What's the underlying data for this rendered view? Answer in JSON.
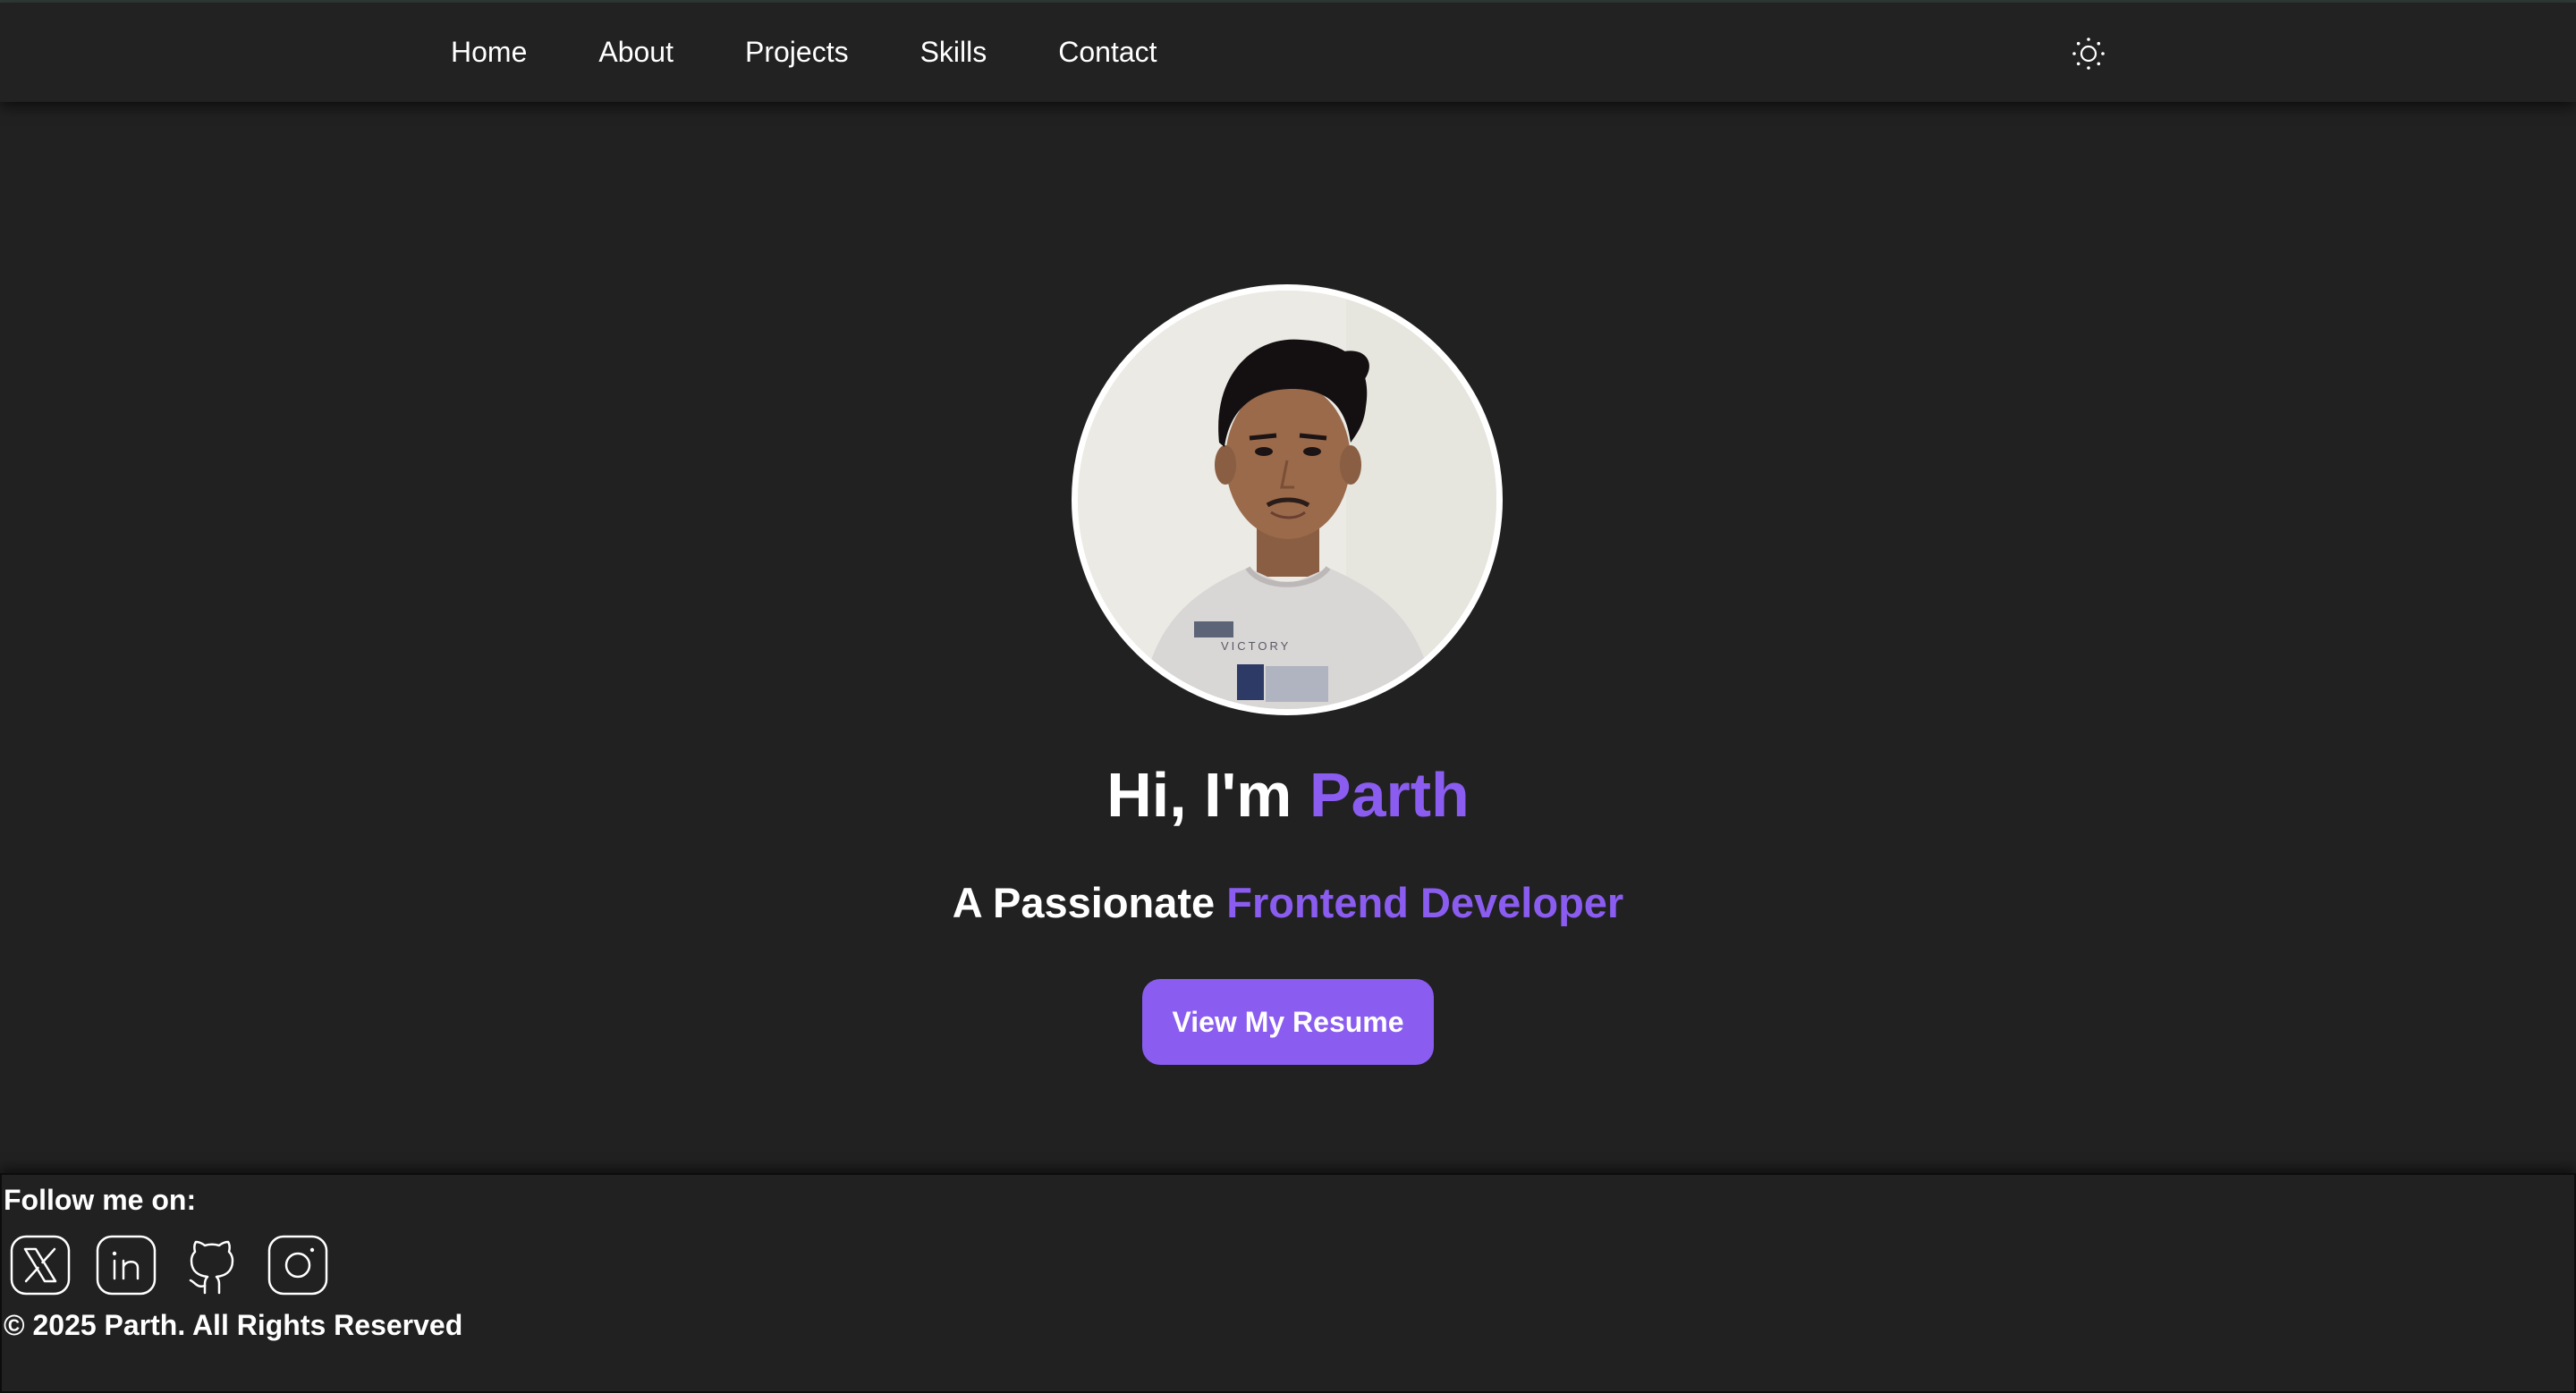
{
  "nav": {
    "items": [
      {
        "label": "Home"
      },
      {
        "label": "About"
      },
      {
        "label": "Projects"
      },
      {
        "label": "Skills"
      },
      {
        "label": "Contact"
      }
    ],
    "theme_toggle_icon": "sun-icon"
  },
  "hero": {
    "avatar_icon": "profile-photo",
    "title_prefix": "Hi, I'm ",
    "title_name": "Parth",
    "subtitle_prefix": "A Passionate ",
    "subtitle_role": "Frontend Developer",
    "resume_button": "View My Resume"
  },
  "footer": {
    "follow_heading": "Follow me on:",
    "social": [
      {
        "icon": "x-twitter-icon"
      },
      {
        "icon": "linkedin-icon"
      },
      {
        "icon": "github-icon"
      },
      {
        "icon": "instagram-icon"
      }
    ],
    "copyright": "© 2025 Parth. All Rights Reserved"
  },
  "colors": {
    "background": "#212121",
    "accent": "#8a5cf0",
    "text": "#ffffff"
  }
}
